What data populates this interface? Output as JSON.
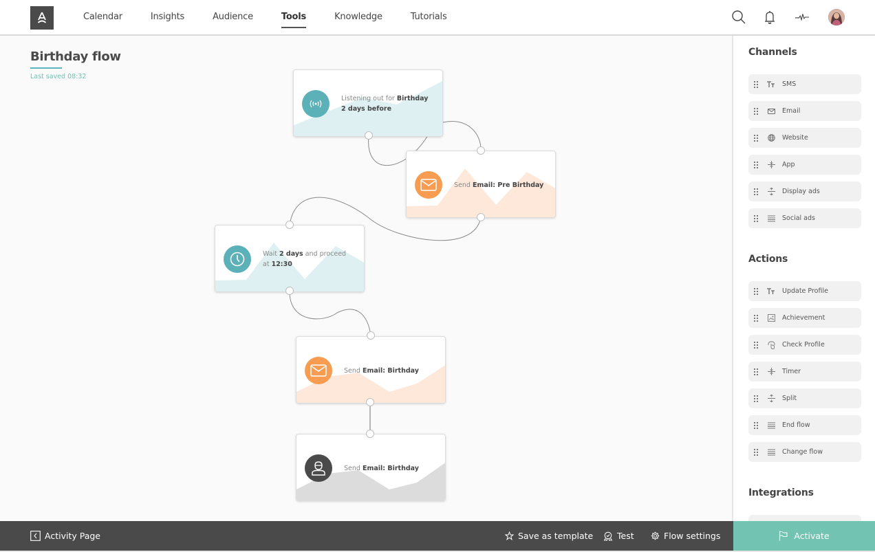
{
  "nav": {
    "logo_alt": "A",
    "items": [
      {
        "label": "Calendar",
        "active": false
      },
      {
        "label": "Insights",
        "active": false
      },
      {
        "label": "Audience",
        "active": false
      },
      {
        "label": "Tools",
        "active": true
      },
      {
        "label": "Knowledge",
        "active": false
      },
      {
        "label": "Tutorials",
        "active": false
      }
    ],
    "icons": [
      "search-icon",
      "bell-icon",
      "activity-icon",
      "avatar"
    ]
  },
  "page": {
    "title": "Birthday flow",
    "last_saved": "Last saved 08:32"
  },
  "colors": {
    "teal": "#5cb0b8",
    "teal_light": "#dff0f2",
    "orange": "#f79c50",
    "orange_light": "#fde8da",
    "dark": "#4a4a4a",
    "grey_light": "#dcdcdc",
    "accent_green": "#72c3b1",
    "saved_text": "#6cc3b3"
  },
  "flow": {
    "nodes": [
      {
        "id": "trigger",
        "icon": "broadcast-icon",
        "prefix": "Listening out for ",
        "bold": "Birthday",
        "line2_bold": "2 days before",
        "suffix": "",
        "line2": ""
      },
      {
        "id": "email-pre",
        "icon": "envelope-icon",
        "prefix": "Send ",
        "bold": "Email: Pre Birthday",
        "suffix": ""
      },
      {
        "id": "wait",
        "icon": "clock-icon",
        "prefix": "Wait ",
        "bold": "2 days",
        "suffix": " and proceed",
        "line2_prefix": "at ",
        "line2_bold": "12:30"
      },
      {
        "id": "email-birthday",
        "icon": "envelope-icon",
        "prefix": "Send ",
        "bold": "Email: Birthday",
        "suffix": ""
      },
      {
        "id": "profile-birthday",
        "icon": "user-icon",
        "prefix": "Send ",
        "bold": "Email: Birthday",
        "suffix": ""
      }
    ]
  },
  "panel": {
    "channels_title": "Channels",
    "channels": [
      {
        "label": "SMS",
        "icon": "text-icon"
      },
      {
        "label": "Email",
        "icon": "envelope-icon"
      },
      {
        "label": "Website",
        "icon": "globe-icon"
      },
      {
        "label": "App",
        "icon": "split-icon"
      },
      {
        "label": "Display ads",
        "icon": "split-arrows-icon"
      },
      {
        "label": "Social ads",
        "icon": "lines-icon"
      }
    ],
    "actions_title": "Actions",
    "actions": [
      {
        "label": "Update Profile",
        "icon": "text-icon"
      },
      {
        "label": "Achievement",
        "icon": "image-icon"
      },
      {
        "label": "Check Profile",
        "icon": "touch-icon"
      },
      {
        "label": "Timer",
        "icon": "split-icon"
      },
      {
        "label": "Split",
        "icon": "split-arrows-icon"
      },
      {
        "label": "End flow",
        "icon": "lines-icon"
      },
      {
        "label": "Change flow",
        "icon": "lines-icon"
      }
    ],
    "integrations_title": "Integrations"
  },
  "bottom": {
    "back_label": "Activity Page",
    "save_template_label": "Save as template",
    "test_label": "Test",
    "flow_settings_label": "Flow settings",
    "activate_label": "Activate"
  }
}
